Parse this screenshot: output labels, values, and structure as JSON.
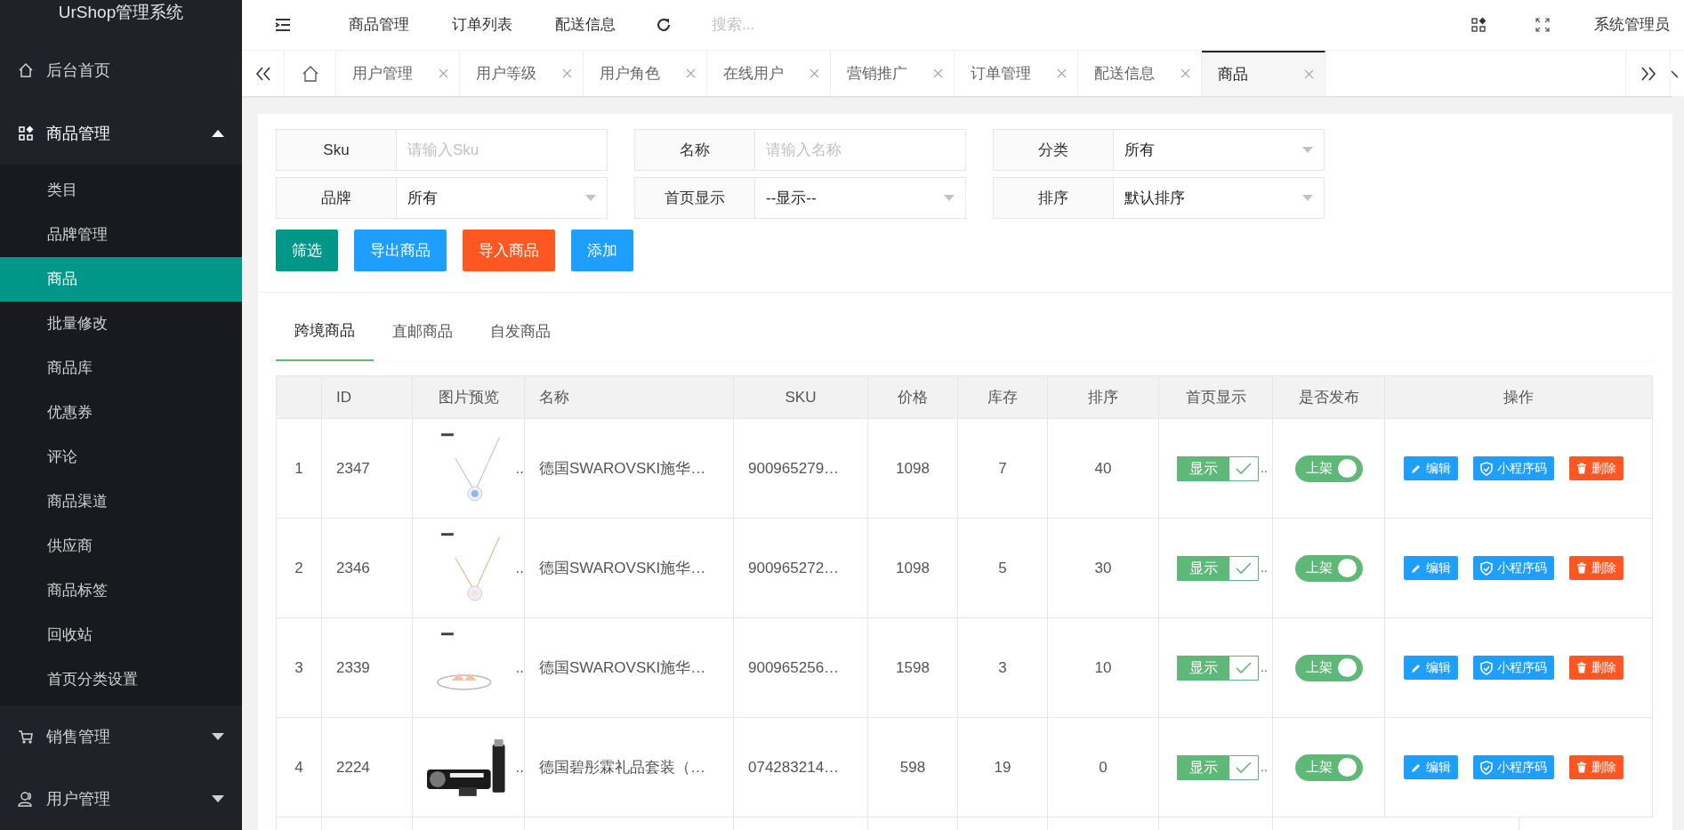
{
  "app_title": "UrShop管理系统",
  "sidebar": {
    "items": [
      {
        "label": "后台首页",
        "kind": "home"
      },
      {
        "label": "商品管理",
        "kind": "apps",
        "expanded": true,
        "children": [
          {
            "label": "类目",
            "selected": false
          },
          {
            "label": "品牌管理",
            "selected": false
          },
          {
            "label": "商品",
            "selected": true
          },
          {
            "label": "批量修改",
            "selected": false
          },
          {
            "label": "商品库",
            "selected": false
          },
          {
            "label": "优惠券",
            "selected": false
          },
          {
            "label": "评论",
            "selected": false
          },
          {
            "label": "商品渠道",
            "selected": false
          },
          {
            "label": "供应商",
            "selected": false
          },
          {
            "label": "商品标签",
            "selected": false
          },
          {
            "label": "回收站",
            "selected": false
          },
          {
            "label": "首页分类设置",
            "selected": false
          }
        ]
      },
      {
        "label": "销售管理",
        "kind": "cart",
        "expanded": false
      },
      {
        "label": "用户管理",
        "kind": "user",
        "expanded": false
      }
    ]
  },
  "top_nav": {
    "links": [
      "商品管理",
      "订单列表",
      "配送信息"
    ],
    "search": {
      "placeholder": "搜索..."
    },
    "user": "系统管理员"
  },
  "page_tabs": [
    {
      "label": "用户管理",
      "selected": false
    },
    {
      "label": "用户等级",
      "selected": false
    },
    {
      "label": "用户角色",
      "selected": false
    },
    {
      "label": "在线用户",
      "selected": false
    },
    {
      "label": "营销推广",
      "selected": false
    },
    {
      "label": "订单管理",
      "selected": false
    },
    {
      "label": "配送信息",
      "selected": false
    },
    {
      "label": "商品",
      "selected": true
    }
  ],
  "filters": [
    {
      "kind": "input",
      "label": "Sku",
      "placeholder": "请输入Sku"
    },
    {
      "kind": "input",
      "label": "名称",
      "placeholder": "请输入名称"
    },
    {
      "kind": "select",
      "label": "分类",
      "value": "所有"
    },
    {
      "kind": "select",
      "label": "品牌",
      "value": "所有"
    },
    {
      "kind": "select",
      "label": "首页显示",
      "value": "--显示--"
    },
    {
      "kind": "select",
      "label": "排序",
      "value": "默认排序"
    }
  ],
  "actions": [
    {
      "label": "筛选",
      "color": "#009688"
    },
    {
      "label": "导出商品",
      "color": "#1e9fff"
    },
    {
      "label": "导入商品",
      "color": "#ff5722"
    },
    {
      "label": "添加",
      "color": "#1e9fff"
    }
  ],
  "product_tabs": [
    {
      "label": "跨境商品",
      "selected": true
    },
    {
      "label": "直邮商品",
      "selected": false
    },
    {
      "label": "自发商品",
      "selected": false
    }
  ],
  "table": {
    "columns": [
      "ID",
      "图片预览",
      "名称",
      "SKU",
      "价格",
      "库存",
      "排序",
      "首页显示",
      "是否发布",
      "操作"
    ],
    "rows": [
      {
        "index": "1",
        "id": "2347",
        "image_more": "..",
        "name": "德国SWAROVSKI施华…",
        "sku": "900965279…",
        "price": "1098",
        "stock": "7",
        "sort": "40",
        "home_display": {
          "label": "显示",
          "checked": true
        },
        "display_more": "..",
        "publish": {
          "label": "上架",
          "on": true
        },
        "ops": [
          "编辑",
          "小程序码",
          "删除"
        ]
      },
      {
        "index": "2",
        "id": "2346",
        "image_more": "..",
        "name": "德国SWAROVSKI施华…",
        "sku": "900965272…",
        "price": "1098",
        "stock": "5",
        "sort": "30",
        "home_display": {
          "label": "显示",
          "checked": true
        },
        "display_more": "..",
        "publish": {
          "label": "上架",
          "on": true
        },
        "ops": [
          "编辑",
          "小程序码",
          "删除"
        ]
      },
      {
        "index": "3",
        "id": "2339",
        "image_more": "..",
        "name": "德国SWAROVSKI施华…",
        "sku": "900965256…",
        "price": "1598",
        "stock": "3",
        "sort": "10",
        "home_display": {
          "label": "显示",
          "checked": true
        },
        "display_more": "..",
        "publish": {
          "label": "上架",
          "on": true
        },
        "ops": [
          "编辑",
          "小程序码",
          "删除"
        ]
      },
      {
        "index": "4",
        "id": "2224",
        "image_more": "..",
        "name": "德国碧彤霖礼品套装（…",
        "sku": "074283214…",
        "price": "598",
        "stock": "19",
        "sort": "0",
        "home_display": {
          "label": "显示",
          "checked": true
        },
        "display_more": "..",
        "publish": {
          "label": "上架",
          "on": true
        },
        "ops": [
          "编辑",
          "小程序码",
          "删除"
        ]
      }
    ]
  }
}
